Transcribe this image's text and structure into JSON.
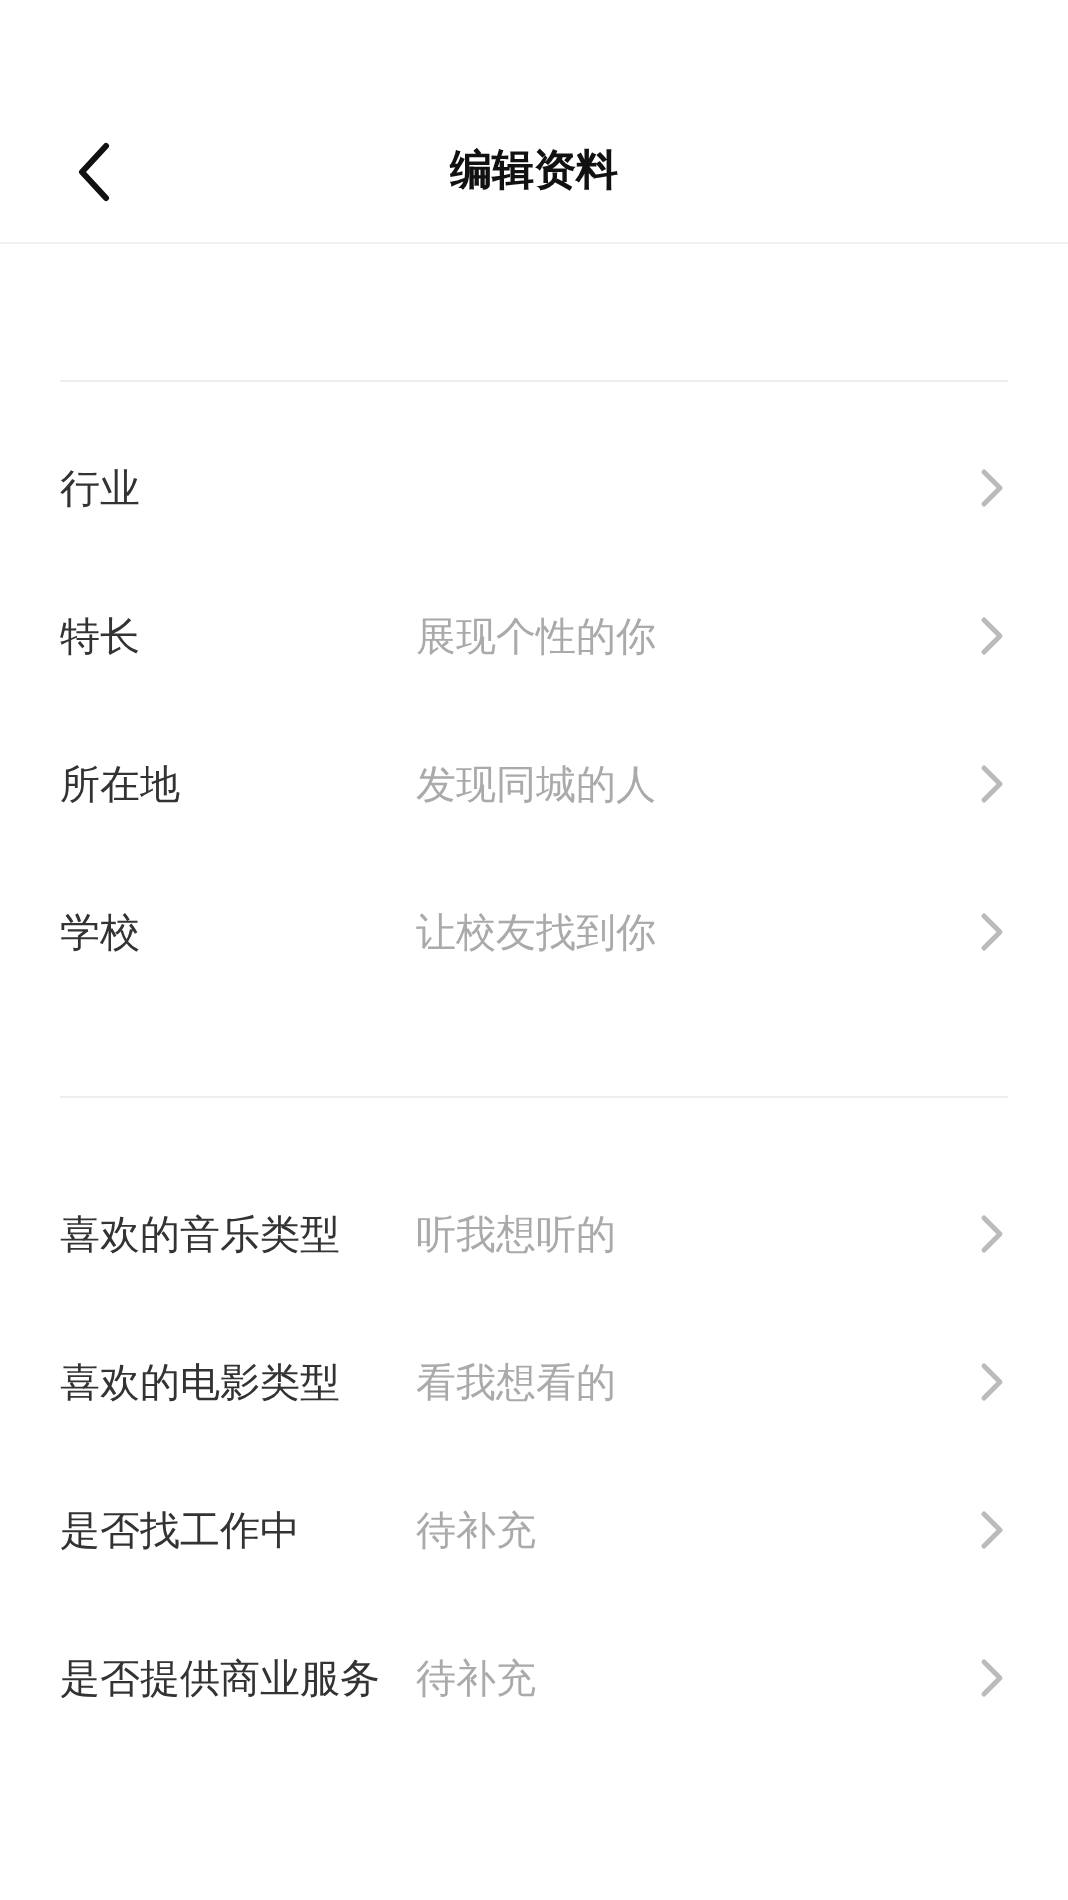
{
  "header": {
    "title": "编辑资料"
  },
  "sections": [
    {
      "rows": [
        {
          "label": "行业"
        },
        {
          "label": "特长",
          "value": "展现个性的你"
        },
        {
          "label": "所在地",
          "value": "发现同城的人"
        },
        {
          "label": "学校",
          "value": "让校友找到你"
        }
      ]
    },
    {
      "rows": [
        {
          "label": "喜欢的音乐类型",
          "value": "听我想听的"
        },
        {
          "label": "喜欢的电影类型",
          "value": "看我想看的"
        },
        {
          "label": "是否找工作中",
          "value": "待补充"
        },
        {
          "label": "是否提供商业服务",
          "value": "待补充"
        }
      ]
    }
  ]
}
